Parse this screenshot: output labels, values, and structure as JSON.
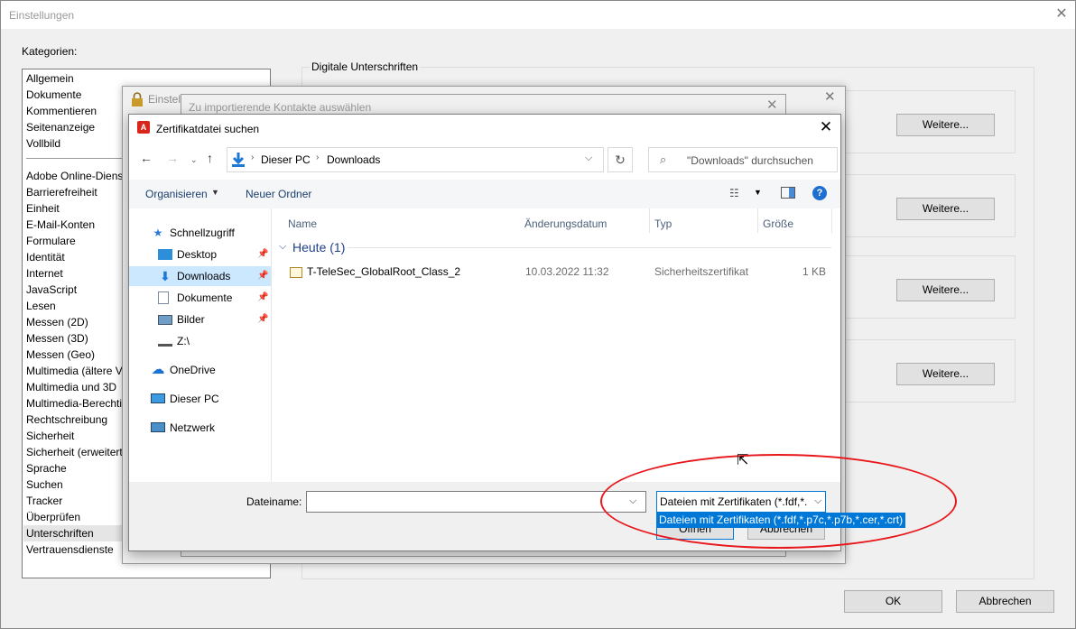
{
  "settings": {
    "title": "Einstellungen",
    "categories_label": "Kategorien:",
    "categories_top": [
      "Allgemein",
      "Dokumente",
      "Kommentieren",
      "Seitenanzeige",
      "Vollbild"
    ],
    "categories": [
      "Adobe Online-Dienst",
      "Barrierefreiheit",
      "Einheit",
      "E-Mail-Konten",
      "Formulare",
      "Identität",
      "Internet",
      "JavaScript",
      "Lesen",
      "Messen (2D)",
      "Messen (3D)",
      "Messen (Geo)",
      "Multimedia (ältere V",
      "Multimedia und 3D",
      "Multimedia-Berechti",
      "Rechtschreibung",
      "Sicherheit",
      "Sicherheit (erweitert)",
      "Sprache",
      "Suchen",
      "Tracker",
      "Überprüfen",
      "Unterschriften",
      "Vertrauensdienste"
    ],
    "selected_category": "Unterschriften",
    "group_label": "Digitale Unterschriften",
    "more_button": "Weitere...",
    "ok_button": "OK",
    "cancel_button": "Abbrechen"
  },
  "mid_dialog": {
    "title": "Einstell"
  },
  "contacts_dialog": {
    "title": "Zu importierende Kontakte auswählen"
  },
  "file_dialog": {
    "title": "Zertifikatdatei suchen",
    "address": {
      "pc": "Dieser PC",
      "folder": "Downloads"
    },
    "search_placeholder": "\"Downloads\" durchsuchen",
    "organize": "Organisieren",
    "new_folder": "Neuer Ordner",
    "nav": [
      {
        "label": "Schnellzugriff",
        "icon": "star-icon"
      },
      {
        "label": "Desktop",
        "icon": "desktop-icon"
      },
      {
        "label": "Downloads",
        "icon": "download-icon"
      },
      {
        "label": "Dokumente",
        "icon": "document-icon"
      },
      {
        "label": "Bilder",
        "icon": "pictures-icon"
      },
      {
        "label": "Z:\\",
        "icon": "network-drive-icon"
      },
      {
        "label": "OneDrive",
        "icon": "cloud-icon"
      },
      {
        "label": "Dieser PC",
        "icon": "computer-icon"
      },
      {
        "label": "Netzwerk",
        "icon": "network-icon"
      }
    ],
    "columns": [
      "Name",
      "Änderungsdatum",
      "Typ",
      "Größe"
    ],
    "group": "Heute (1)",
    "files": [
      {
        "name": "T-TeleSec_GlobalRoot_Class_2",
        "date": "10.03.2022 11:32",
        "type": "Sicherheitszertifikat",
        "size": "1 KB"
      }
    ],
    "filename_label": "Dateiname:",
    "filename_value": "",
    "filter_selected": "Dateien mit Zertifikaten (*.fdf,*.",
    "filter_option": "Dateien mit Zertifikaten (*.fdf,*.p7c,*.p7b,*.cer,*.crt)",
    "open_button": "Öffnen",
    "cancel_button": "Abbrechen"
  },
  "colors": {
    "accent": "#0078d7",
    "annotation": "#e8171b",
    "selection": "#cce8ff"
  }
}
